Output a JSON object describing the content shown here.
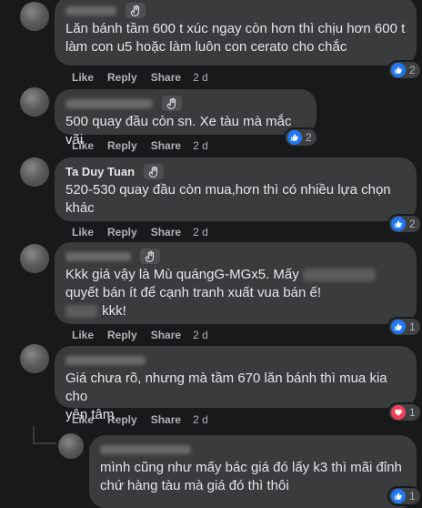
{
  "comments": [
    {
      "name": "",
      "lines": [
        "Lăn bánh tầm 600 t xúc ngay còn hơn thì chịu hơn 600 t",
        "làm con u5 hoặc làm luôn con cerato cho chắc"
      ],
      "actions": {
        "like": "Like",
        "reply": "Reply",
        "share": "Share",
        "time": "2 d"
      },
      "reaction": {
        "type": "like-icon",
        "count": "2"
      }
    },
    {
      "name": "",
      "lines": [
        "500 quay đầu còn sn. Xe tàu mà mắc vãi"
      ],
      "actions": {
        "like": "Like",
        "reply": "Reply",
        "share": "Share",
        "time": "2 d"
      },
      "reaction": {
        "type": "like-icon",
        "count": "2"
      }
    },
    {
      "name": "Ta Duy Tuan",
      "lines": [
        "520-530 quay đầu còn mua,hơn thì có nhiều lựa chọn",
        "khác"
      ],
      "actions": {
        "like": "Like",
        "reply": "Reply",
        "share": "Share",
        "time": "2 d"
      },
      "reaction": {
        "type": "like-icon",
        "count": "2"
      }
    },
    {
      "name": "",
      "line1": "Kkk giá vậy là Mù quángG-MGx5. Mấy",
      "line2": "quyết bán ít để cạnh tranh xuất vua bán ế!",
      "line3": "kkk!",
      "actions": {
        "like": "Like",
        "reply": "Reply",
        "share": "Share",
        "time": "2 d"
      },
      "reaction": {
        "type": "like-icon",
        "count": "1"
      }
    },
    {
      "name": "",
      "lines": [
        "Giá chưa rõ, nhưng mà tầm 670 lăn bánh thì mua kia cho",
        "yên tâm"
      ],
      "actions": {
        "like": "Like",
        "reply": "Reply",
        "share": "Share",
        "time": "2 d"
      },
      "reaction": {
        "type": "love-icon",
        "count": "1"
      }
    },
    {
      "name": "",
      "lines": [
        "mình cũng như mấy bác giá đó lấy k3 thì mãi đỉnh",
        "chứ hàng tàu mà giá đó thì thôi"
      ],
      "reaction": {
        "type": "like-icon",
        "count": "1"
      }
    }
  ],
  "colors": {
    "like": "#2078f4",
    "love": "#f33e58",
    "bubble": "#3a3b3c",
    "background": "#18191a"
  }
}
